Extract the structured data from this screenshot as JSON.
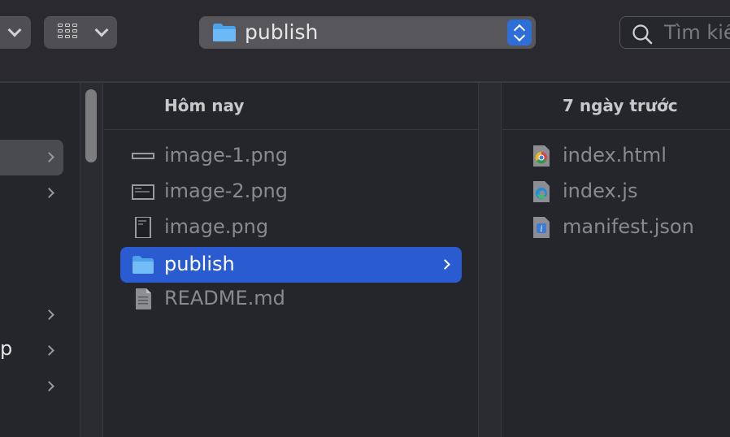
{
  "toolbar": {
    "path_label": "publish",
    "search_placeholder": "Tìm kiếm"
  },
  "left_column": {
    "rows": [
      {
        "label": "",
        "has_chevron": true,
        "selected": true
      },
      {
        "label": "",
        "has_chevron": true
      },
      {
        "label": "",
        "has_chevron": true
      },
      {
        "label": "p",
        "has_chevron": true
      },
      {
        "label": "",
        "has_chevron": true
      }
    ]
  },
  "middle_column": {
    "header": "Hôm nay",
    "files": [
      {
        "name": "image-1.png",
        "icon": "image-thumb-icon"
      },
      {
        "name": "image-2.png",
        "icon": "image-thumb-icon"
      },
      {
        "name": "image.png",
        "icon": "image-thumb-icon"
      },
      {
        "name": "publish",
        "icon": "folder-icon",
        "selected": true
      },
      {
        "name": "README.md",
        "icon": "document-icon"
      }
    ]
  },
  "right_column": {
    "header": "7 ngày trước",
    "files": [
      {
        "name": "index.html",
        "icon": "chrome-html-icon"
      },
      {
        "name": "index.js",
        "icon": "edge-js-icon"
      },
      {
        "name": "manifest.json",
        "icon": "json-file-icon"
      }
    ]
  },
  "colors": {
    "selection": "#2a5bd0",
    "background": "#25262b",
    "folder": "#5aaef0"
  }
}
